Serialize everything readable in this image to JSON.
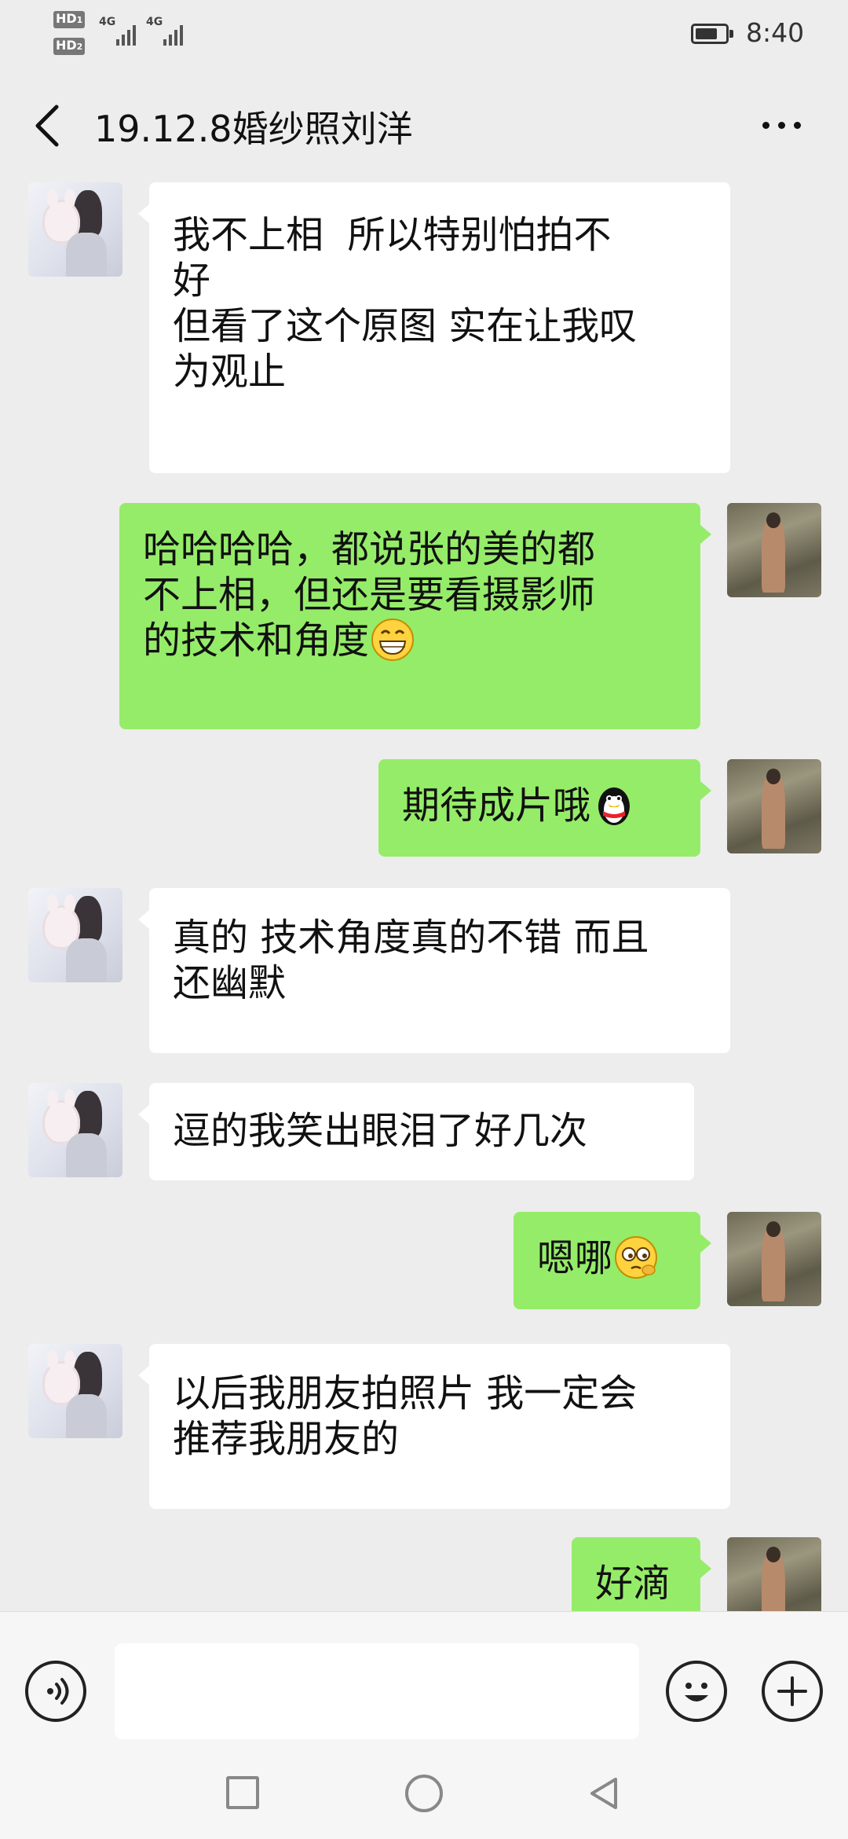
{
  "status_bar": {
    "sim1_label": "HD",
    "sim1_index": "1",
    "sim2_label": "HD",
    "sim2_index": "2",
    "network1": "4G",
    "network2": "4G",
    "battery_level": 0.75,
    "time": "8:40"
  },
  "header": {
    "back_icon": "chevron-left-icon",
    "title": "19.12.8婚纱照刘洋",
    "more_icon": "more-dots-icon"
  },
  "messages": [
    {
      "sender": "friend",
      "text": "我不上相  所以特别怕拍不\n好\n但看了这个原图 实在让我叹\n为观止"
    },
    {
      "sender": "self",
      "text": "哈哈哈哈，都说张的美的都\n不上相，但还是要看摄影师\n的技术和角度",
      "emoji": "grin-emoji"
    },
    {
      "sender": "self",
      "text": "期待成片哦",
      "emoji": "penguin-emoji"
    },
    {
      "sender": "friend",
      "text": "真的 技术角度真的不错 而且\n还幽默"
    },
    {
      "sender": "friend",
      "text": "逗的我笑出眼泪了好几次"
    },
    {
      "sender": "self",
      "text": "嗯哪",
      "emoji": "shy-emoji"
    },
    {
      "sender": "friend",
      "text": "以后我朋友拍照片 我一定会\n推荐我朋友的"
    },
    {
      "sender": "self",
      "text": "好滴"
    }
  ],
  "input_bar": {
    "voice_icon": "voice-icon",
    "text_value": "",
    "emoji_icon": "smiley-icon",
    "plus_icon": "plus-icon"
  },
  "nav_bar": {
    "recents_icon": "square-icon",
    "home_icon": "circle-icon",
    "back_icon": "triangle-back-icon"
  }
}
